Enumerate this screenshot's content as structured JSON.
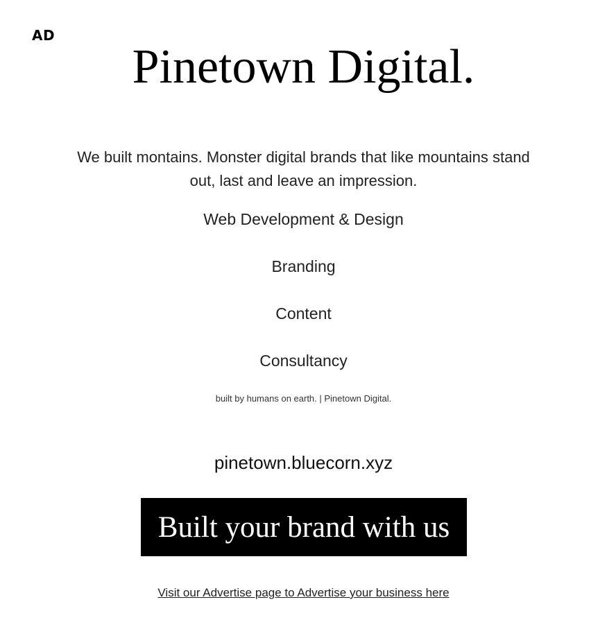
{
  "ad_label": "AD",
  "brand": {
    "title": "Pinetown Digital."
  },
  "tagline": "We built montains. Monster digital brands that like mountains stand out, last and leave an impression.",
  "services": [
    {
      "label": "Web Development & Design"
    },
    {
      "label": "Branding"
    },
    {
      "label": "Content"
    },
    {
      "label": "Consultancy"
    }
  ],
  "footer_note": "built by humans on earth. | Pinetown Digital.",
  "website": "pinetown.bluecorn.xyz",
  "cta": {
    "label": "Built your brand with us",
    "background_color": "#000000",
    "text_color": "#ffffff"
  },
  "advertise_link": "Visit our Advertise page to Advertise your business here"
}
